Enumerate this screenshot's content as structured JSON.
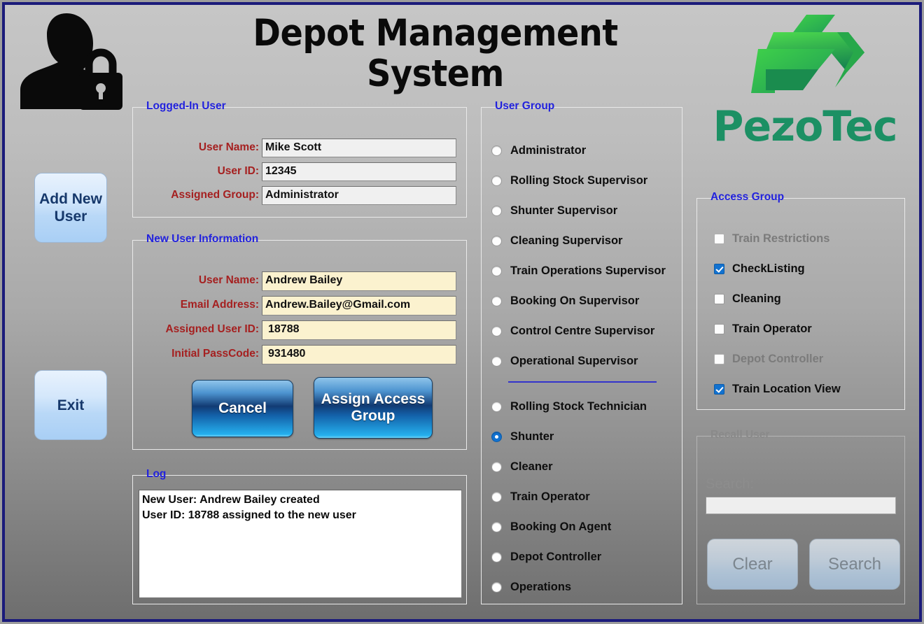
{
  "window": {
    "border_color": "#1b1b7a",
    "title": "Depot Management System"
  },
  "header": {
    "title_line1": "Depot Management",
    "title_line2": "System",
    "user_icon": "user-lock-icon",
    "logo_word": "PezoTec",
    "logo_color": "#1c9064"
  },
  "sidebar": {
    "add_new_user": "Add New\nUser",
    "add_new_user_line1": "Add New",
    "add_new_user_line2": "User",
    "exit": "Exit"
  },
  "logged_in_user": {
    "legend": "Logged-In User",
    "fields": [
      {
        "label": "User Name:",
        "value": "Mike Scott"
      },
      {
        "label": "User ID:",
        "value": "12345"
      },
      {
        "label": "Assigned Group:",
        "value": "Administrator"
      }
    ]
  },
  "new_user": {
    "legend": "New User Information",
    "fields": [
      {
        "label": "User Name:",
        "value": "Andrew Bailey"
      },
      {
        "label": "Email Address:",
        "value": "Andrew.Bailey@Gmail.com"
      },
      {
        "label": "Assigned User ID:",
        "value": "18788"
      },
      {
        "label": "Initial PassCode:",
        "value": "931480"
      }
    ],
    "cancel_label": "Cancel",
    "assign_label_line1": "Assign Access",
    "assign_label_line2": "Group"
  },
  "log": {
    "legend": "Log",
    "lines": [
      "New User: Andrew Bailey created",
      "User ID: 18788 assigned to the new user"
    ]
  },
  "user_group": {
    "legend": "User Group",
    "supervisors": [
      {
        "label": "Administrator",
        "selected": false
      },
      {
        "label": "Rolling Stock Supervisor",
        "selected": false
      },
      {
        "label": "Shunter Supervisor",
        "selected": false
      },
      {
        "label": "Cleaning Supervisor",
        "selected": false
      },
      {
        "label": "Train Operations Supervisor",
        "selected": false
      },
      {
        "label": "Booking On Supervisor",
        "selected": false
      },
      {
        "label": "Control Centre Supervisor",
        "selected": false
      },
      {
        "label": "Operational Supervisor",
        "selected": false
      }
    ],
    "staff": [
      {
        "label": "Rolling Stock Technician",
        "selected": false
      },
      {
        "label": "Shunter",
        "selected": true
      },
      {
        "label": "Cleaner",
        "selected": false
      },
      {
        "label": "Train Operator",
        "selected": false
      },
      {
        "label": "Booking On Agent",
        "selected": false
      },
      {
        "label": "Depot Controller",
        "selected": false
      },
      {
        "label": "Operations",
        "selected": false
      }
    ],
    "selected_value": "Shunter",
    "separator_color": "#3333cc"
  },
  "access_group": {
    "legend": "Access Group",
    "items": [
      {
        "label": "Train Restrictions",
        "checked": false,
        "enabled": false
      },
      {
        "label": "CheckListing",
        "checked": true,
        "enabled": true
      },
      {
        "label": "Cleaning",
        "checked": false,
        "enabled": true
      },
      {
        "label": "Train Operator",
        "checked": false,
        "enabled": true
      },
      {
        "label": "Depot Controller",
        "checked": false,
        "enabled": false
      },
      {
        "label": "Train Location View",
        "checked": true,
        "enabled": true
      }
    ],
    "checked_color": "#1272d0"
  },
  "recall_user": {
    "legend": "Recall User",
    "enabled": false,
    "search_label": "Search:",
    "search_value": "",
    "clear_label": "Clear",
    "search_button_label": "Search"
  }
}
